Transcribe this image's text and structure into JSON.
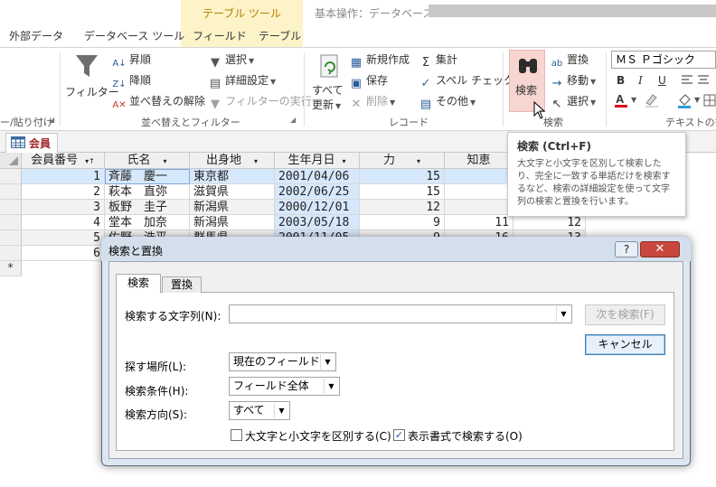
{
  "ribbon": {
    "contextual_group_title": "テーブル ツール",
    "document_title": "基本操作：データベース-",
    "tabs": [
      "外部データ",
      "データベース ツール",
      "フィールド",
      "テーブル"
    ],
    "clipboard_partial": "ー/貼り付け",
    "sort_filter": {
      "filter_label": "フィルター",
      "ascending": "昇順",
      "descending": "降順",
      "clear_sort": "並べ替えの解除",
      "selection": "選択",
      "advanced": "詳細設定",
      "toggle_filter": "フィルターの実行",
      "group_label": "並べ替えとフィルター"
    },
    "records": {
      "refresh_all_1": "すべて",
      "refresh_all_2": "更新",
      "new": "新規作成",
      "save": "保存",
      "delete": "削除",
      "totals": "集計",
      "spelling": "スペル チェック",
      "more": "その他",
      "group_label": "レコード"
    },
    "find": {
      "find_label": "検索",
      "replace": "置換",
      "goto": "移動",
      "select": "選択",
      "group_label": "検索"
    },
    "text_format": {
      "font_name": "ＭＳ Ｐゴシック",
      "bold": "B",
      "italic": "I",
      "underline": "U",
      "group_label": "テキストの書"
    }
  },
  "tooltip": {
    "title": "検索 (Ctrl+F)",
    "text": "大文字と小文字を区別して検索したり、完全に一致する単語だけを検索するなど、検索の詳細設定を使って文字列の検索と置換を行います。"
  },
  "table": {
    "tab_label": "会員",
    "columns": [
      "会員番号",
      "氏名",
      "出身地",
      "生年月日",
      "力",
      "知恵"
    ],
    "rows": [
      [
        "1",
        "斉藤　慶一",
        "東京都",
        "2001/04/06",
        "15",
        "",
        ""
      ],
      [
        "2",
        "萩本　直弥",
        "滋賀県",
        "2002/06/25",
        "15",
        "",
        ""
      ],
      [
        "3",
        "板野　圭子",
        "新潟県",
        "2000/12/01",
        "12",
        "",
        ""
      ],
      [
        "4",
        "堂本　加奈",
        "新潟県",
        "2003/05/18",
        "9",
        "11",
        "12"
      ],
      [
        "5",
        "佐野　浩平",
        "群馬県",
        "2001/11/05",
        "9",
        "16",
        "13"
      ],
      [
        "6",
        "",
        "",
        "",
        "",
        "",
        ""
      ]
    ],
    "new_row_marker": "*"
  },
  "dialog": {
    "title": "検索と置換",
    "help": "?",
    "close": "✕",
    "tabs": [
      "検索",
      "置換"
    ],
    "find_what_label": "検索する文字列(N):",
    "find_what_value": "",
    "find_next": "次を検索(F)",
    "cancel": "キャンセル",
    "look_in_label": "探す場所(L):",
    "look_in_value": "現在のフィールド",
    "match_label": "検索条件(H):",
    "match_value": "フィールド全体",
    "search_label": "検索方向(S):",
    "search_value": "すべて",
    "match_case_label": "大文字と小文字を区別する(C)",
    "match_case_checked": false,
    "search_formatted_label": "表示書式で検索する(O)",
    "search_formatted_checked": true
  }
}
